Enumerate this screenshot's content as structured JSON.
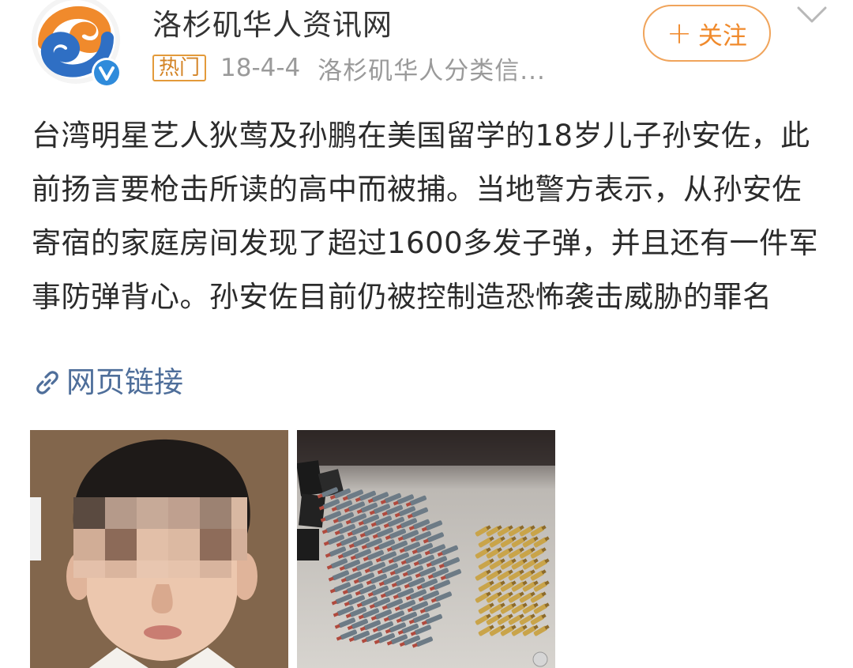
{
  "account": {
    "name": "洛杉矶华人资讯网",
    "avatar_icon": "site-logo-icon",
    "verified_icon": "verified-v-icon"
  },
  "meta": {
    "hot_badge": "热门",
    "date": "18-4-4",
    "source": "洛杉矶华人分类信..."
  },
  "follow": {
    "plus": "+",
    "label": "关注"
  },
  "post": {
    "text": "台湾明星艺人狄莺及孙鹏在美国留学的18岁儿子孙安佐，此前扬言要枪击所读的高中而被捕。当地警方表示，从孙安佐寄宿的家庭房间发现了超过1600多发子弹，并且还有一件军事防弹背心。孙安佐目前仍被控制造恐怖袭击威胁的罪名",
    "link_label": "网页链接"
  },
  "images": [
    {
      "name": "mugshot-photo"
    },
    {
      "name": "bullets-photo"
    }
  ],
  "colors": {
    "accent_orange": "#f08a2c",
    "link_blue": "#4e6e9a",
    "meta_gray": "#9a9a9a"
  }
}
